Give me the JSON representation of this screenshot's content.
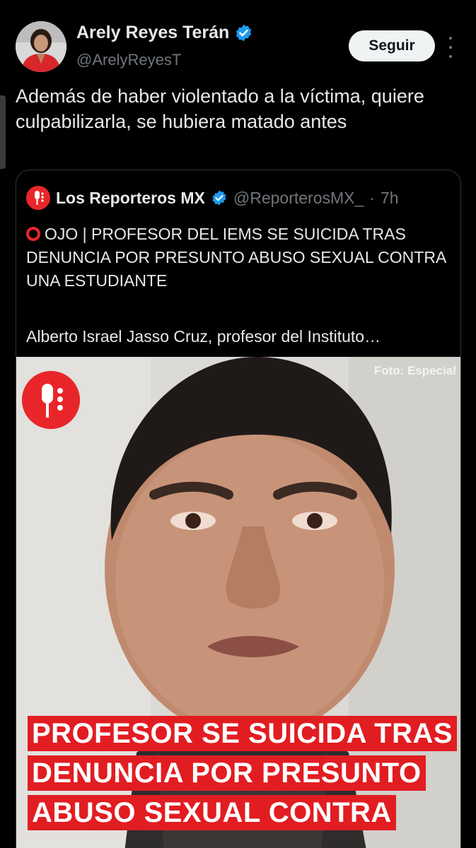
{
  "author": {
    "display_name": "Arely Reyes Terán",
    "handle": "@ArelyReyesT",
    "verified_icon": "verified-badge-icon"
  },
  "follow_button": {
    "label": "Seguir"
  },
  "more_icon": "more-options-icon",
  "tweet": {
    "text": "Además de haber violentado a la víctima, quiere culpabilizarla, se hubiera matado antes"
  },
  "quoted_tweet": {
    "display_name": "Los Reporteros MX",
    "handle": "@ReporterosMX_",
    "separator": "·",
    "time": "7h",
    "headline_text": "OJO | PROFESOR DEL IEMS SE SUICIDA TRAS DENUNCIA POR PRESUNTO ABUSO SEXUAL CONTRA UNA ESTUDIANTE",
    "snippet": "Alberto Israel Jasso Cruz, profesor del Instituto…",
    "media": {
      "credit": "Foto: Especial",
      "headline_lines": [
        "PROFESOR SE SUICIDA TRAS",
        "DENUNCIA POR PRESUNTO",
        "ABUSO SEXUAL CONTRA"
      ]
    }
  },
  "colors": {
    "background": "#000000",
    "brand_red": "#e8262a",
    "verified_blue": "#1d9bf0",
    "text_primary": "#e7e9ea",
    "text_secondary": "#71767b"
  }
}
